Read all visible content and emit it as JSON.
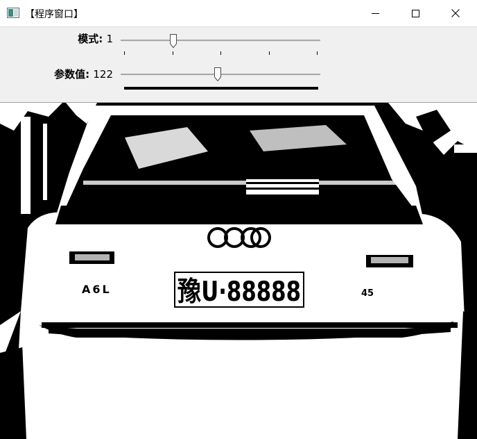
{
  "window": {
    "title": "【程序窗口】",
    "icon": "app-window-icon",
    "controls": [
      "minimize-icon",
      "maximize-icon",
      "close-icon"
    ]
  },
  "trackbars": [
    {
      "label": "模式:",
      "value": "1",
      "min": 0,
      "max": 4,
      "position": 1
    },
    {
      "label": "参数值:",
      "value": "122",
      "min": 0,
      "max": 255,
      "position": 122
    }
  ],
  "image": {
    "plate_text": "豫U·88888",
    "model_badge": "A6L",
    "engine_badge": "45"
  }
}
